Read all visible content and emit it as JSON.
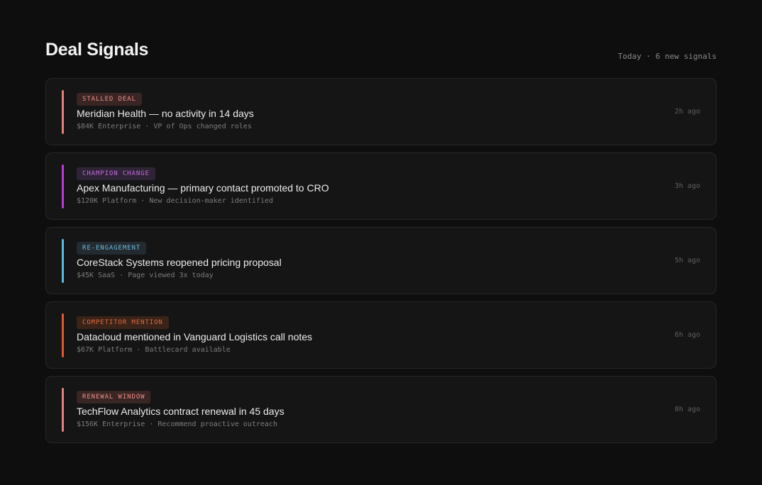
{
  "header": {
    "title": "Deal Signals",
    "meta": "Today · 6 new signals"
  },
  "signals": [
    {
      "tag": "STALLED DEAL",
      "title": "Meridian Health — no activity in 14 days",
      "meta": "$84K Enterprise · VP of Ops changed roles",
      "time": "2h ago",
      "accent": "#e57f7a",
      "badge_bg": "#3a2525",
      "badge_fg": "#ea8f88"
    },
    {
      "tag": "CHAMPION CHANGE",
      "title": "Apex Manufacturing — primary contact promoted to CRO",
      "meta": "$120K Platform · New decision-maker identified",
      "time": "3h ago",
      "accent": "#b93bd6",
      "badge_bg": "#2f2436",
      "badge_fg": "#c06bdc"
    },
    {
      "tag": "RE-ENGAGEMENT",
      "title": "CoreStack Systems reopened pricing proposal",
      "meta": "$45K SaaS · Page viewed 3x today",
      "time": "5h ago",
      "accent": "#5bb8de",
      "badge_bg": "#232b31",
      "badge_fg": "#6fb9d9"
    },
    {
      "tag": "COMPETITOR MENTION",
      "title": "Datacloud mentioned in Vanguard Logistics call notes",
      "meta": "$67K Platform · Battlecard available",
      "time": "6h ago",
      "accent": "#e2572d",
      "badge_bg": "#3a2318",
      "badge_fg": "#e06a3f"
    },
    {
      "tag": "RENEWAL WINDOW",
      "title": "TechFlow Analytics contract renewal in 45 days",
      "meta": "$156K Enterprise · Recommend proactive outreach",
      "time": "8h ago",
      "accent": "#e57f7a",
      "badge_bg": "#3a2525",
      "badge_fg": "#ea8f88"
    }
  ]
}
